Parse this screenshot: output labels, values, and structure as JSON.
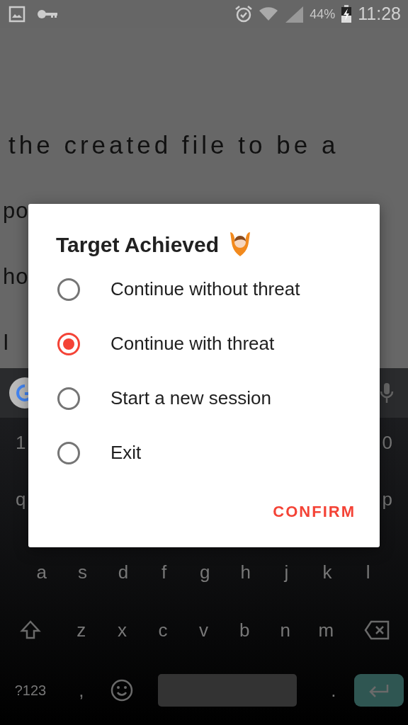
{
  "status_bar": {
    "battery": "44%",
    "time": "11:28"
  },
  "background_text": [
    "the created file to be a",
    "po",
    "ho",
    "I"
  ],
  "dialog": {
    "title": "Target Achieved",
    "options": [
      {
        "label": "Continue without threat",
        "selected": false
      },
      {
        "label": "Continue with threat",
        "selected": true
      },
      {
        "label": "Start a new session",
        "selected": false
      },
      {
        "label": "Exit",
        "selected": false
      }
    ],
    "confirm": "CONFIRM"
  },
  "keyboard": {
    "number_row": [
      "1",
      "0"
    ],
    "top_row": [
      "q",
      "p"
    ],
    "home_row": [
      "a",
      "s",
      "d",
      "f",
      "g",
      "h",
      "j",
      "k",
      "l"
    ],
    "letter_row": [
      "z",
      "x",
      "c",
      "v",
      "b",
      "n",
      "m"
    ],
    "symbols_key": "?123",
    "comma_key": ",",
    "period_key": "."
  }
}
